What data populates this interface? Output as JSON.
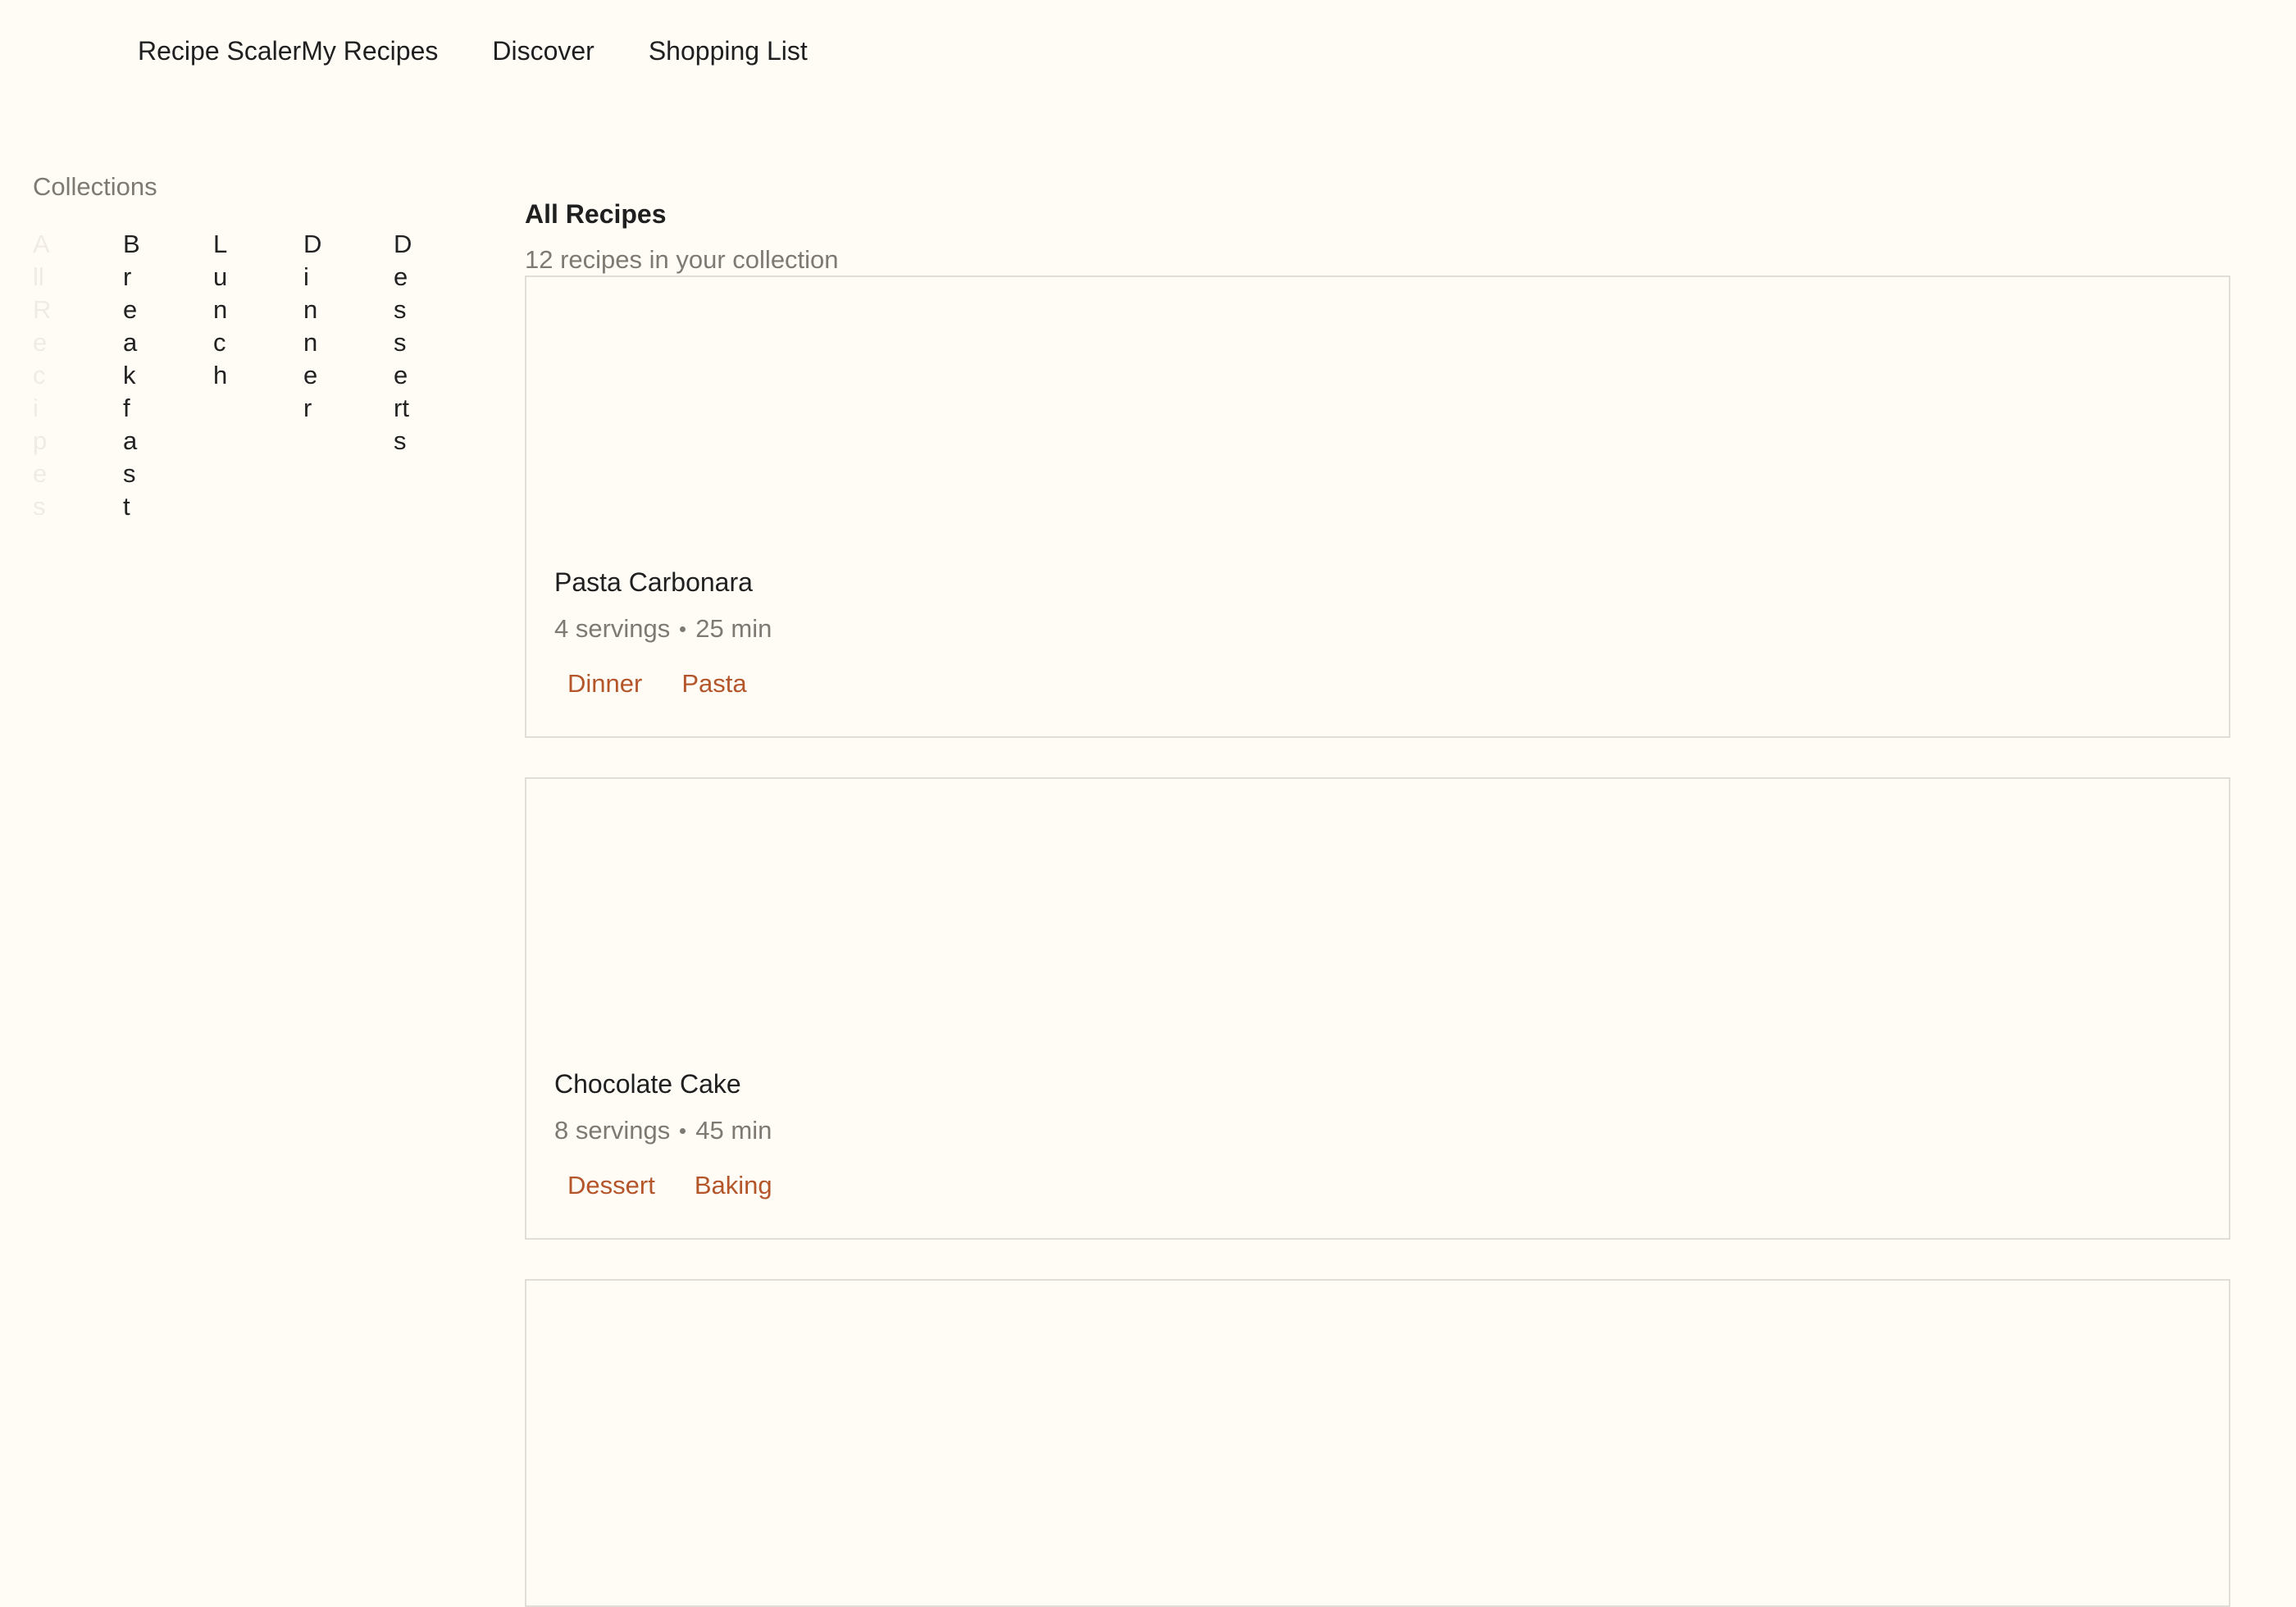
{
  "nav": {
    "brand": "Recipe Scaler",
    "links": [
      "My Recipes",
      "Discover",
      "Shopping List"
    ]
  },
  "sidebar": {
    "title": "Collections",
    "items": [
      {
        "label": "All Recipes"
      },
      {
        "label": "Breakfast"
      },
      {
        "label": "Lunch"
      },
      {
        "label": "Dinner"
      },
      {
        "label": "Desserts"
      }
    ]
  },
  "main": {
    "title": "All Recipes",
    "subtitle": "12 recipes in your collection"
  },
  "recipes": [
    {
      "title": "Pasta Carbonara",
      "servings": "4 servings",
      "time": "25 min",
      "tags": [
        "Dinner",
        "Pasta"
      ]
    },
    {
      "title": "Chocolate Cake",
      "servings": "8 servings",
      "time": "45 min",
      "tags": [
        "Dessert",
        "Baking"
      ]
    }
  ],
  "colors": {
    "background": "#fffcf6",
    "tag": "#b4552a",
    "muted": "#7e7a72",
    "border": "#e2ddd5"
  }
}
